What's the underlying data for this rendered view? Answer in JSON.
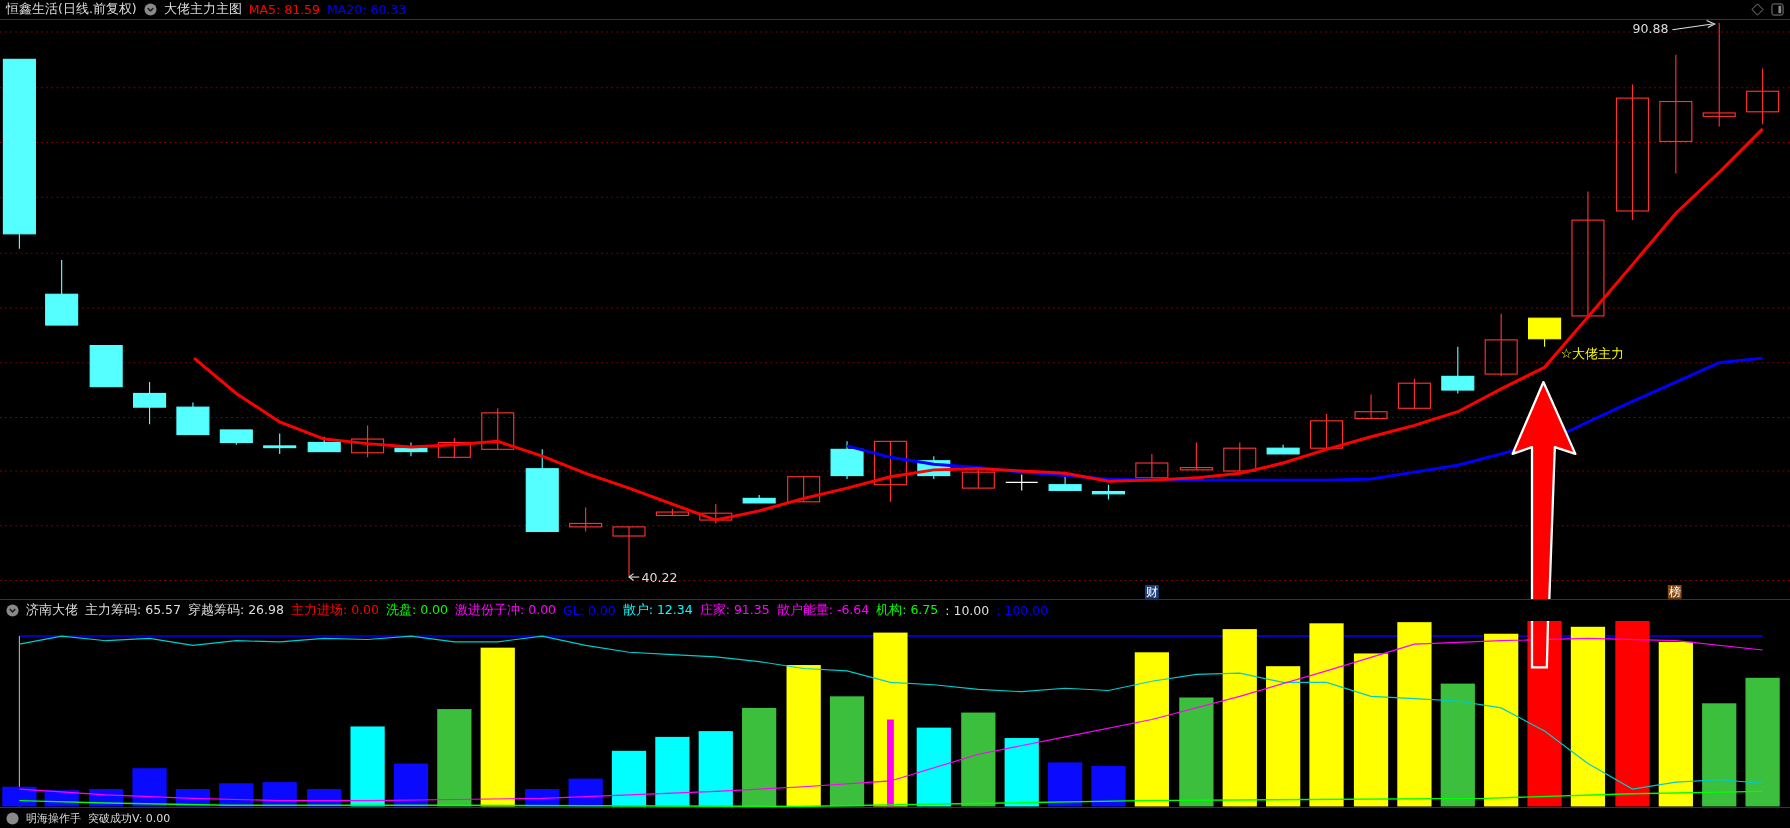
{
  "title_bar": {
    "stock": "恒鑫生活(日线.前复权)",
    "indicator": "大佬主力主图",
    "readings": [
      {
        "text": "MA5: 81.59",
        "color": "#ff0000"
      },
      {
        "text": "MA20: 60.33",
        "color": "#0000ff"
      }
    ]
  },
  "main_chart": {
    "high_label": "90.88",
    "low_label": "40.22",
    "signal_label": "☆大佬主力",
    "markers": [
      {
        "text": "财",
        "color": "#1f3f7f"
      },
      {
        "text": "榜",
        "color": "#8b4a10"
      }
    ]
  },
  "lower_panel": {
    "title": "济南大佬",
    "readings": [
      {
        "text": "主力筹码: 65.57",
        "color": "#dddddd"
      },
      {
        "text": "穿越筹码: 26.98",
        "color": "#dddddd"
      },
      {
        "text": "主力进场: 0.00",
        "color": "#ff0000"
      },
      {
        "text": "洗盘: 0.00",
        "color": "#00ff00"
      },
      {
        "text": "激进份子冲: 0.00",
        "color": "#ff00ff"
      },
      {
        "text": "GL: 0.00",
        "color": "#0000ff"
      },
      {
        "text": "散户: 12.34",
        "color": "#00ffff"
      },
      {
        "text": "庄家: 91.35",
        "color": "#ff00ff"
      },
      {
        "text": "散户能量: -6.64",
        "color": "#ff00ff"
      },
      {
        "text": "机构: 6.75",
        "color": "#00ff00"
      },
      {
        "text": ": 10.00",
        "color": "#dddddd"
      },
      {
        "text": ": 100.00",
        "color": "#0000ff"
      }
    ]
  },
  "bottom_panel": {
    "title": "明海操作手",
    "reading": "突破成功V: 0.00"
  }
}
